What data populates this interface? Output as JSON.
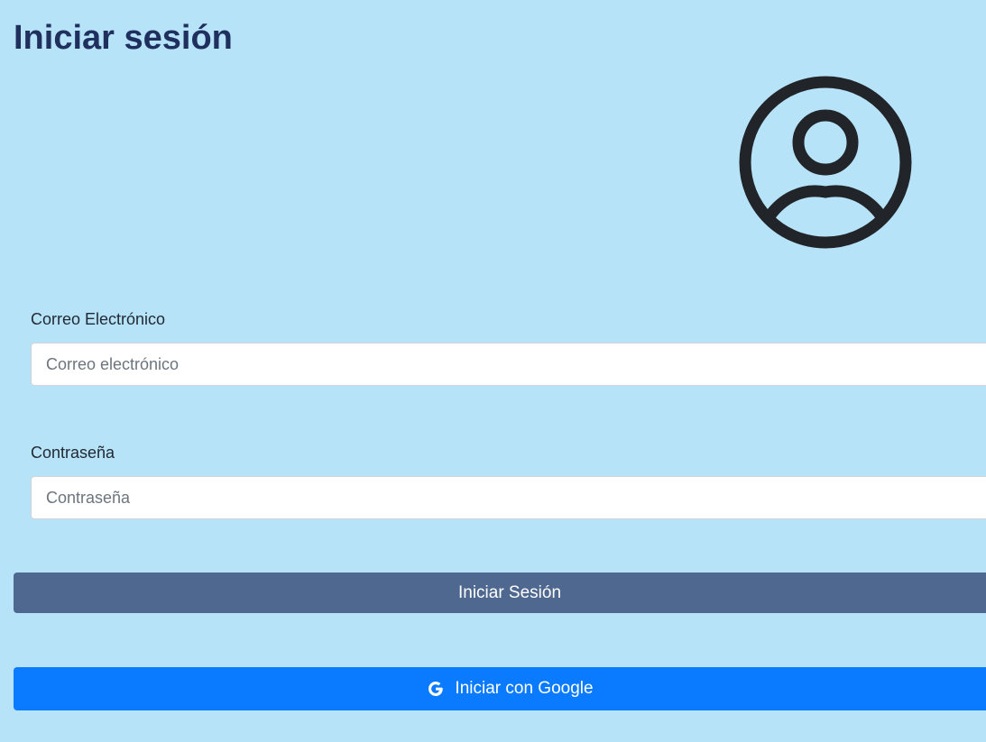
{
  "page": {
    "title": "Iniciar sesión"
  },
  "avatar": {
    "icon": "user-circle-icon"
  },
  "email": {
    "label": "Correo Electrónico",
    "placeholder": "Correo electrónico",
    "value": ""
  },
  "password": {
    "label": "Contraseña",
    "placeholder": "Contraseña",
    "value": ""
  },
  "buttons": {
    "login_label": "Iniciar Sesión",
    "google_label": "Iniciar con Google",
    "google_icon": "google-g-icon"
  },
  "colors": {
    "background": "#b6e3f7",
    "title": "#1f2f5e",
    "login_button": "#4f6890",
    "google_button": "#0a7bff"
  }
}
